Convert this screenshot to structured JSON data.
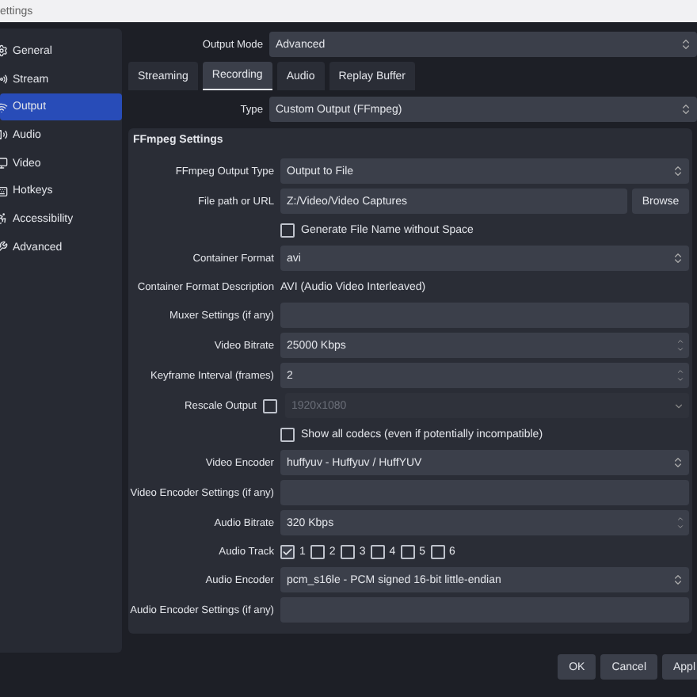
{
  "window": {
    "title": "ettings"
  },
  "sidebar": {
    "items": [
      {
        "label": "General",
        "selected": false
      },
      {
        "label": "Stream",
        "selected": false
      },
      {
        "label": "Output",
        "selected": true
      },
      {
        "label": "Audio",
        "selected": false
      },
      {
        "label": "Video",
        "selected": false
      },
      {
        "label": "Hotkeys",
        "selected": false
      },
      {
        "label": "Accessibility",
        "selected": false
      },
      {
        "label": "Advanced",
        "selected": false
      }
    ]
  },
  "output_mode": {
    "label": "Output Mode",
    "value": "Advanced"
  },
  "tabs": [
    {
      "label": "Streaming",
      "selected": false
    },
    {
      "label": "Recording",
      "selected": true
    },
    {
      "label": "Audio",
      "selected": false
    },
    {
      "label": "Replay Buffer",
      "selected": false
    }
  ],
  "type": {
    "label": "Type",
    "value": "Custom Output (FFmpeg)"
  },
  "group": {
    "title": "FFmpeg Settings",
    "rows": [
      {
        "kind": "combo",
        "label": "FFmpeg Output Type",
        "value": "Output to File"
      },
      {
        "kind": "browse",
        "label": "File path or URL",
        "value": "Z:/Video/Video Captures",
        "button": "Browse"
      },
      {
        "kind": "check",
        "label": "Generate File Name without Space",
        "checked": false
      },
      {
        "kind": "combo",
        "label": "Container Format",
        "value": "avi"
      },
      {
        "kind": "info",
        "label": "Container Format Description",
        "value": "AVI (Audio Video Interleaved)"
      },
      {
        "kind": "text",
        "label": "Muxer Settings (if any)"
      },
      {
        "kind": "spin",
        "label": "Video Bitrate",
        "value": "25000 Kbps"
      },
      {
        "kind": "spin",
        "label": "Keyframe Interval (frames)",
        "value": "2"
      },
      {
        "kind": "rescale",
        "label": "Rescale Output",
        "checked": false,
        "value": "1920x1080",
        "disabled": true
      },
      {
        "kind": "check",
        "label": "Show all codecs (even if potentially incompatible)",
        "checked": false
      },
      {
        "kind": "combo",
        "label": "Video Encoder",
        "value": "huffyuv - Huffyuv / HuffYUV"
      },
      {
        "kind": "text",
        "label": "Video Encoder Settings (if any)"
      },
      {
        "kind": "spin",
        "label": "Audio Bitrate",
        "value": "320 Kbps"
      },
      {
        "kind": "tracks",
        "label": "Audio Track",
        "tracks": [
          {
            "label": "1",
            "checked": true
          },
          {
            "label": "2",
            "checked": false
          },
          {
            "label": "3",
            "checked": false
          },
          {
            "label": "4",
            "checked": false
          },
          {
            "label": "5",
            "checked": false
          },
          {
            "label": "6",
            "checked": false
          }
        ]
      },
      {
        "kind": "combo",
        "label": "Audio Encoder",
        "value": "pcm_s16le - PCM signed 16-bit little-endian"
      },
      {
        "kind": "text",
        "label": "Audio Encoder Settings (if any)"
      }
    ]
  },
  "buttons": [
    "OK",
    "Cancel",
    "Appl"
  ]
}
